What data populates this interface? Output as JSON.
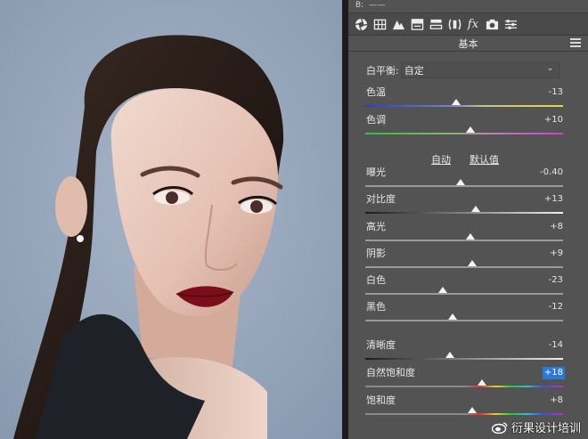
{
  "colors": {
    "panel": "#535353",
    "accent_highlight": "#2b78d8",
    "photo_background": "#97a7bc"
  },
  "topbar": {
    "label": "B:",
    "value": "——"
  },
  "toolbar_icons": [
    "aperture-icon",
    "grid-icon",
    "mountain-icon",
    "split-tone-icon",
    "detail-icon",
    "lens-icon",
    "fx-icon",
    "camera-icon",
    "sliders-icon"
  ],
  "toolbar_fx_label": "fx",
  "section": {
    "title": "基本"
  },
  "white_balance": {
    "label": "白平衡:",
    "value": "自定"
  },
  "auto_label": "自动",
  "default_label": "默认值",
  "sliders": [
    {
      "id": "temperature",
      "label": "色温",
      "value": "-13",
      "fraction": 0.46,
      "track": "temp"
    },
    {
      "id": "tint",
      "label": "色调",
      "value": "+10",
      "fraction": 0.53,
      "track": "tint"
    },
    {
      "id": "exposure",
      "label": "曝光",
      "value": "-0.40",
      "fraction": 0.48,
      "track": "plain"
    },
    {
      "id": "contrast",
      "label": "对比度",
      "value": "+13",
      "fraction": 0.56,
      "track": "contrast"
    },
    {
      "id": "highlights",
      "label": "高光",
      "value": "+8",
      "fraction": 0.53,
      "track": "plain"
    },
    {
      "id": "shadows",
      "label": "阴影",
      "value": "+9",
      "fraction": 0.54,
      "track": "plain"
    },
    {
      "id": "whites",
      "label": "白色",
      "value": "-23",
      "fraction": 0.39,
      "track": "plain"
    },
    {
      "id": "blacks",
      "label": "黑色",
      "value": "-12",
      "fraction": 0.44,
      "track": "plain"
    },
    {
      "id": "clarity",
      "label": "清晰度",
      "value": "-14",
      "fraction": 0.43,
      "track": "contrast"
    },
    {
      "id": "vibrance",
      "label": "自然饱和度",
      "value": "+18",
      "fraction": 0.59,
      "track": "sat",
      "highlighted": true
    },
    {
      "id": "saturation",
      "label": "饱和度",
      "value": "+8",
      "fraction": 0.54,
      "track": "sat"
    }
  ],
  "watermark": {
    "text": "衍果设计培训"
  }
}
